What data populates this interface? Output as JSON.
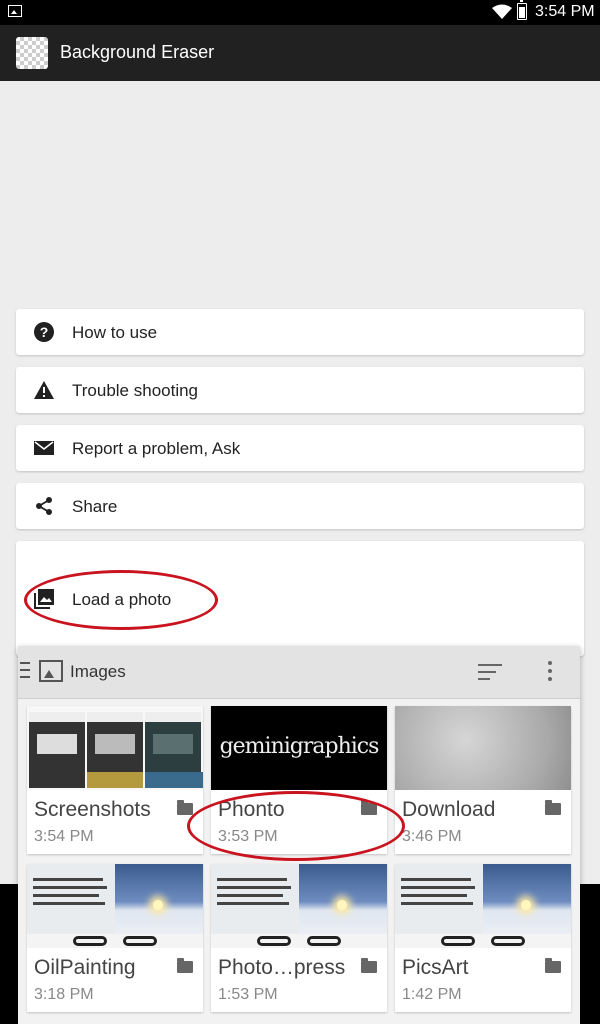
{
  "status_bar": {
    "time": "3:54 PM"
  },
  "app_bar": {
    "title": "Background Eraser",
    "logo_icon": "checkerboard-logo-icon"
  },
  "menu": {
    "items": [
      {
        "label": "How to use",
        "icon": "help-circle-icon"
      },
      {
        "label": "Trouble shooting",
        "icon": "warning-icon"
      },
      {
        "label": "Report a problem, Ask",
        "icon": "mail-icon"
      },
      {
        "label": "Share",
        "icon": "share-icon"
      },
      {
        "label": "Load a photo",
        "icon": "photo-library-icon"
      }
    ]
  },
  "picker": {
    "title": "Images",
    "folders": [
      {
        "name": "Screenshots",
        "time": "3:54 PM"
      },
      {
        "name": "Phonto",
        "time": "3:53 PM"
      },
      {
        "name": "Download",
        "time": "3:46 PM"
      },
      {
        "name": "OilPainting",
        "time": "3:18 PM"
      },
      {
        "name": "Photo…press",
        "time": "1:53 PM"
      },
      {
        "name": "PicsArt",
        "time": "1:42 PM"
      }
    ],
    "phonto_thumb_text": "geminigraphics"
  },
  "colors": {
    "app_bar": "#212121",
    "annotation": "#c9141f",
    "background": "#ededed"
  }
}
